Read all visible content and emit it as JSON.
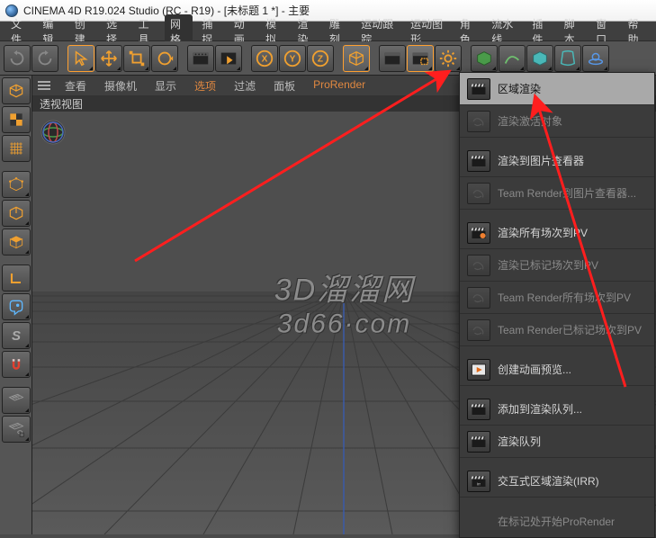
{
  "window": {
    "title": "CINEMA 4D R19.024 Studio (RC - R19) - [未标题 1 *] - 主要"
  },
  "menu": {
    "items": [
      "文件",
      "编辑",
      "创建",
      "选择",
      "工具",
      "网格",
      "捕捉",
      "动画",
      "模拟",
      "渲染",
      "雕刻",
      "运动跟踪",
      "运动图形",
      "角色",
      "流水线",
      "插件",
      "脚本",
      "窗口",
      "帮助"
    ]
  },
  "viewport": {
    "menu": [
      "查看",
      "摄像机",
      "显示",
      "选项",
      "过滤",
      "面板",
      "ProRender"
    ],
    "tab": "透视视图"
  },
  "watermark": {
    "line1": "3D溜溜网",
    "line2": "3d66·com"
  },
  "render_menu": {
    "items": [
      {
        "label": "区域渲染",
        "icon": "clapper",
        "enabled": true,
        "highlight": true
      },
      {
        "label": "渲染激活对象",
        "icon": "swirl",
        "enabled": false
      },
      {
        "label": "渲染到图片查看器",
        "icon": "clapper",
        "enabled": true
      },
      {
        "label": "Team Render到图片查看器...",
        "icon": "swirl",
        "enabled": false
      },
      {
        "label": "渲染所有场次到PV",
        "icon": "clapper-orange",
        "enabled": true
      },
      {
        "label": "渲染已标记场次到PV",
        "icon": "swirl",
        "enabled": false
      },
      {
        "label": "Team Render所有场次到PV",
        "icon": "swirl",
        "enabled": false
      },
      {
        "label": "Team Render已标记场次到PV",
        "icon": "swirl",
        "enabled": false
      },
      {
        "label": "创建动画预览...",
        "icon": "play",
        "enabled": true
      },
      {
        "label": "添加到渲染队列...",
        "icon": "clapper",
        "enabled": true
      },
      {
        "label": "渲染队列",
        "icon": "clapper",
        "enabled": true
      },
      {
        "label": "交互式区域渲染(IRR)",
        "icon": "clapper-irr",
        "enabled": true
      },
      {
        "label": "在标记处开始ProRender",
        "icon": "none",
        "enabled": false,
        "textOnly": true
      }
    ]
  },
  "palette_icons": [
    "cube",
    "checker",
    "grid",
    "cube-pts",
    "cube-wire",
    "cube-solid",
    "l-shape",
    "mouse",
    "s-letter",
    "magnet",
    "floor1",
    "floor2"
  ],
  "toolbar_icons": [
    "undo",
    "redo",
    "sep",
    "pointer",
    "move",
    "rotate",
    "loop",
    "sep",
    "clapper1",
    "clapper-play",
    "sep",
    "x-axis",
    "y-axis",
    "z-axis",
    "sep",
    "cube-hl",
    "sep",
    "clapper2",
    "clapper3",
    "gear",
    "sep",
    "green1",
    "green2",
    "cyan1",
    "cyan2",
    "ring"
  ]
}
